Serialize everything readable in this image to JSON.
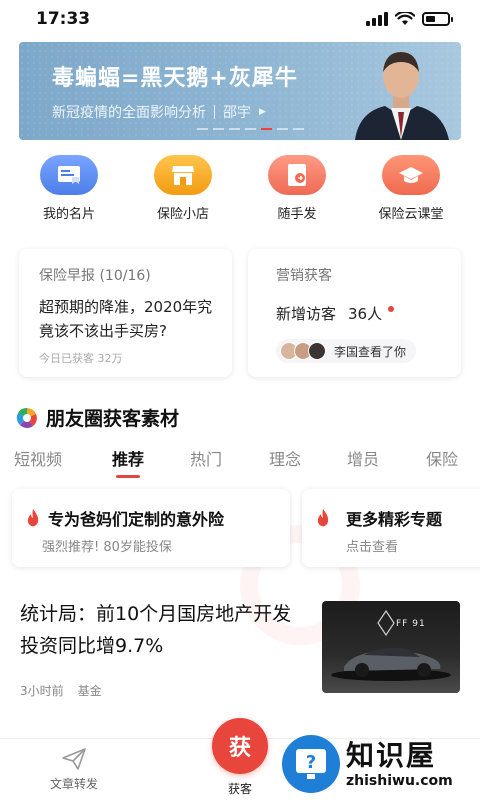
{
  "status_bar": {
    "time": "17:33",
    "battery_level": 0.45
  },
  "banner": {
    "title": "毒蝙蝠=黑天鹅+灰犀牛",
    "subtitle": "新冠疫情的全面影响分析",
    "author": "邵宇",
    "slide_count": 7,
    "active_slide": 4,
    "accent_color": "#e8463d"
  },
  "quick_actions": [
    {
      "label": "我的名片",
      "icon": "business-card-icon",
      "color": "#5b8ef0"
    },
    {
      "label": "保险小店",
      "icon": "shop-icon",
      "color": "#f5a623"
    },
    {
      "label": "随手发",
      "icon": "share-document-icon",
      "color": "#f07c5b"
    },
    {
      "label": "保险云课堂",
      "icon": "graduation-cap-icon",
      "color": "#f0745b"
    }
  ],
  "briefing": {
    "header": "保险早报 (10/16)",
    "headline": "超预期的降准，2020年究竟该不该出手买房?",
    "footer": "今日已获客 32万"
  },
  "marketing": {
    "header": "营销获客",
    "visitors_label": "新增访客",
    "visitors_count": "36人",
    "viewer_text": "李国查看了你"
  },
  "section": {
    "title": "朋友圈获客素材"
  },
  "tabs": [
    {
      "label": "短视频"
    },
    {
      "label": "推荐"
    },
    {
      "label": "热门"
    },
    {
      "label": "理念"
    },
    {
      "label": "增员"
    },
    {
      "label": "保险"
    }
  ],
  "active_tab": "推荐",
  "topics": [
    {
      "title": "专为爸妈们定制的意外险",
      "subtitle": "强烈推荐! 80岁能投保"
    },
    {
      "title": "更多精彩专题",
      "subtitle": "点击查看"
    }
  ],
  "news": {
    "title": "统计局：前10个月国房地产开发投资同比增9.7%",
    "time": "3小时前",
    "category": "基金",
    "thumb_text": "FF 91"
  },
  "bottom_nav": {
    "share_label": "文章转发",
    "center_label": "获客",
    "center_glyph": "获"
  },
  "watermark": {
    "name": "知识屋",
    "url": "zhishiwu.com"
  }
}
